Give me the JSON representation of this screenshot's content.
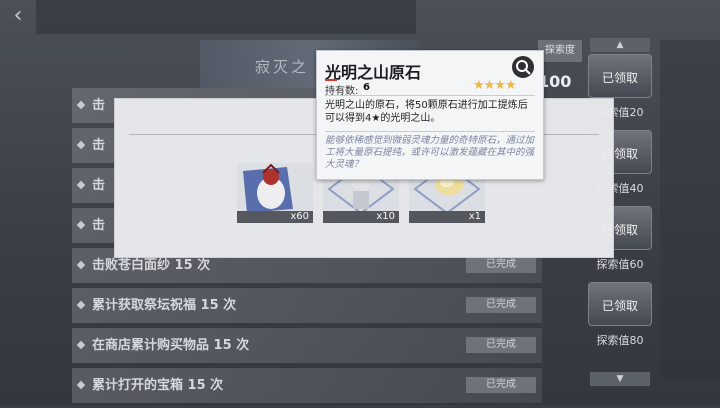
{
  "banner": {
    "title": "寂灭之"
  },
  "tasks": [
    {
      "label": "击",
      "status": ""
    },
    {
      "label": "击",
      "status": ""
    },
    {
      "label": "击",
      "status": ""
    },
    {
      "label": "击",
      "status": ""
    },
    {
      "label": "击败苍白面纱 15 次",
      "status": "已完成"
    },
    {
      "label": "累计获取祭坛祝福 15 次",
      "status": "已完成"
    },
    {
      "label": "在商店累计购买物品 15 次",
      "status": "已完成"
    },
    {
      "label": "累计打开的宝箱 15 次",
      "status": "已完成"
    }
  ],
  "explore": {
    "header": "探索度",
    "value": "100"
  },
  "rewards": [
    {
      "claimed": "已领取",
      "explore": "探索值20"
    },
    {
      "claimed": "已领取",
      "explore": "探索值40"
    },
    {
      "claimed": "已领取",
      "explore": "探索值60"
    },
    {
      "claimed": "已领取",
      "explore": "探索值80"
    }
  ],
  "popup": {
    "slots": [
      {
        "count": "x60"
      },
      {
        "count": "x10"
      },
      {
        "count": "x1"
      }
    ]
  },
  "tooltip": {
    "title": "光明之山原石",
    "count_label": "持有数:",
    "count_value": "6",
    "stars": "★★★★",
    "description": "光明之山的原石，将50颗原石进行加工提炼后可以得到4★的光明之山。",
    "flavor": "能够依稀感觉到微弱灵魂力量的奇特原石，通过加工将大量原石提纯，或许可以激发蕴藏在其中的强大灵魂？"
  },
  "colors": {
    "star": "#e9b84a",
    "accent_red": "#d13a2e",
    "flavor_text": "#7c86a0"
  }
}
